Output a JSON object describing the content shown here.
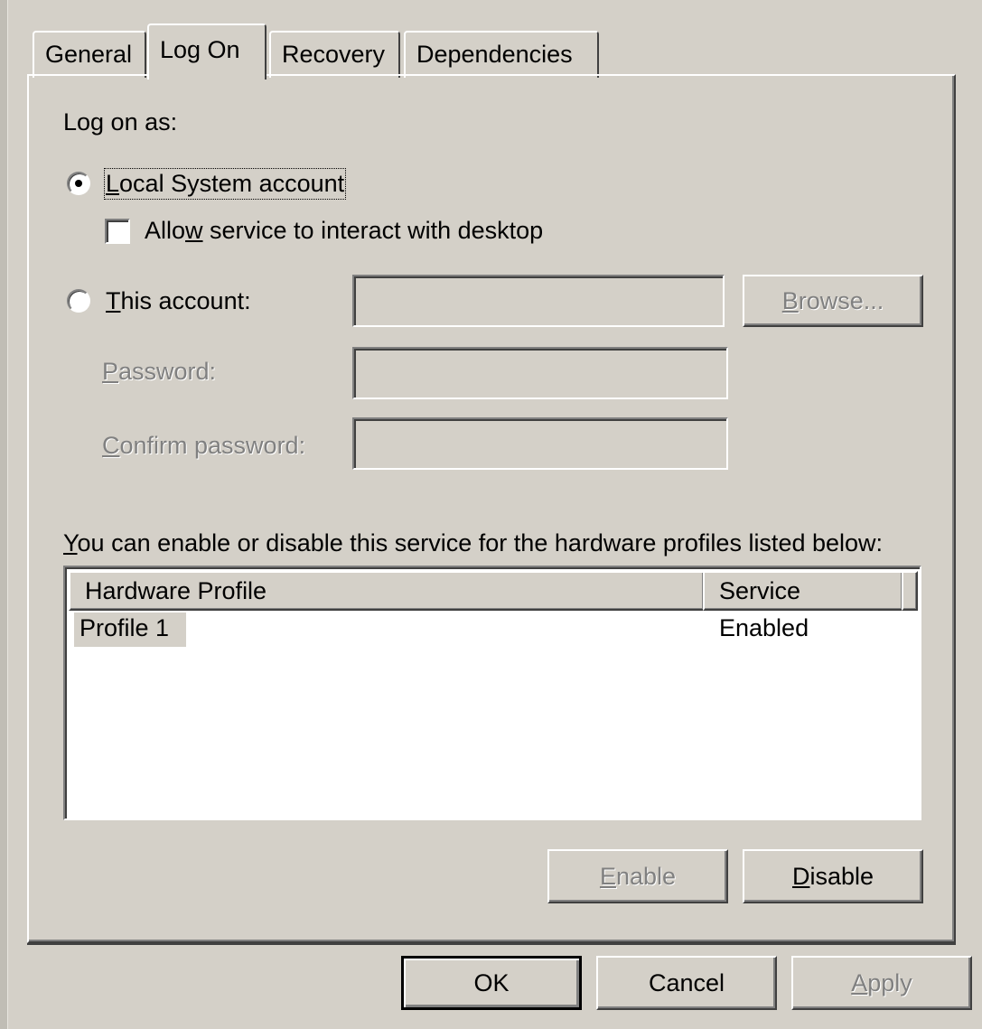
{
  "tabs": [
    "General",
    "Log On",
    "Recovery",
    "Dependencies"
  ],
  "active_tab": "Log On",
  "logon": {
    "log_on_as_label": "Log on as:",
    "local_system_label": "Local System account",
    "local_system_checked": true,
    "allow_interact_label": "Allow service to interact with desktop",
    "allow_interact_checked": false,
    "this_account_label": "This account:",
    "this_account_checked": false,
    "account_value": "",
    "browse_label": "Browse...",
    "password_label": "Password:",
    "password_value": "",
    "confirm_password_label": "Confirm password:",
    "confirm_password_value": ""
  },
  "profiles": {
    "description": "You can enable or disable this service for the hardware profiles listed below:",
    "columns": [
      "Hardware Profile",
      "Service"
    ],
    "rows": [
      {
        "profile": "Profile 1",
        "service": "Enabled"
      }
    ],
    "enable_label": "Enable",
    "disable_label": "Disable"
  },
  "footer": {
    "ok_label": "OK",
    "cancel_label": "Cancel",
    "apply_label": "Apply"
  },
  "colors": {
    "face": "#d4d0c8",
    "highlight": "#ffffff",
    "shadow": "#808080",
    "dark_shadow": "#404040",
    "disabled_text": "#808080"
  }
}
